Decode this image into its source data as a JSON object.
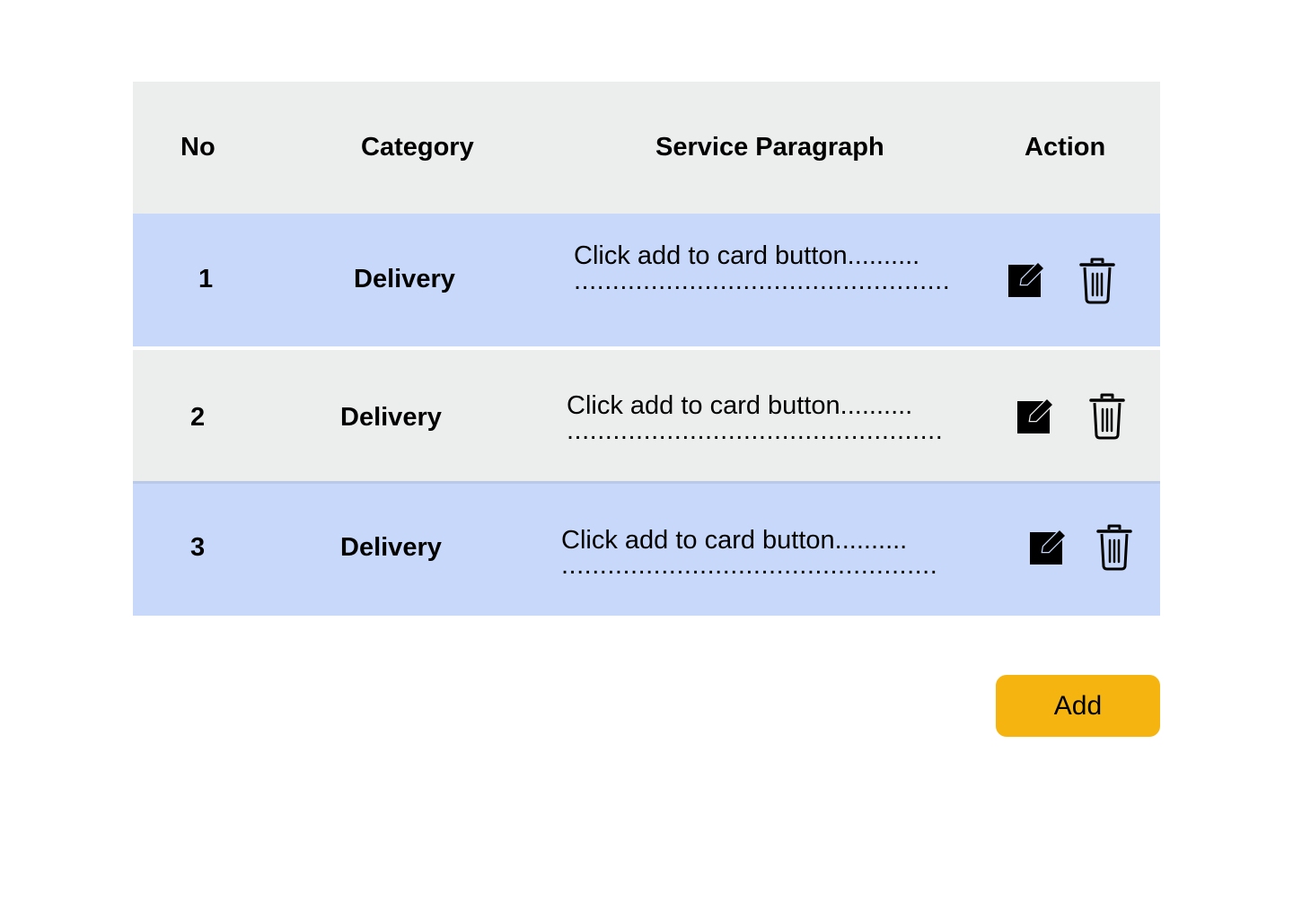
{
  "table": {
    "headers": {
      "no": "No",
      "category": "Category",
      "paragraph": "Service Paragraph",
      "action": "Action"
    },
    "rows": [
      {
        "no": "1",
        "category": "Delivery",
        "paragraph_line1": "Click add to card button..........",
        "paragraph_line2": "..................................................",
        "edit_icon": "edit-icon",
        "delete_icon": "trash-icon"
      },
      {
        "no": "2",
        "category": "Delivery",
        "paragraph_line1": "Click add to card button..........",
        "paragraph_line2": "..................................................",
        "edit_icon": "edit-icon",
        "delete_icon": "trash-icon"
      },
      {
        "no": "3",
        "category": "Delivery",
        "paragraph_line1": "Click add to card button..........",
        "paragraph_line2": "..................................................",
        "edit_icon": "edit-icon",
        "delete_icon": "trash-icon"
      }
    ]
  },
  "add_button": {
    "label": "Add"
  },
  "colors": {
    "header_bg": "#eceeed",
    "row_blue": "#c7d8fa",
    "row_grey": "#eceeed",
    "add_button_bg": "#f5b40f"
  }
}
